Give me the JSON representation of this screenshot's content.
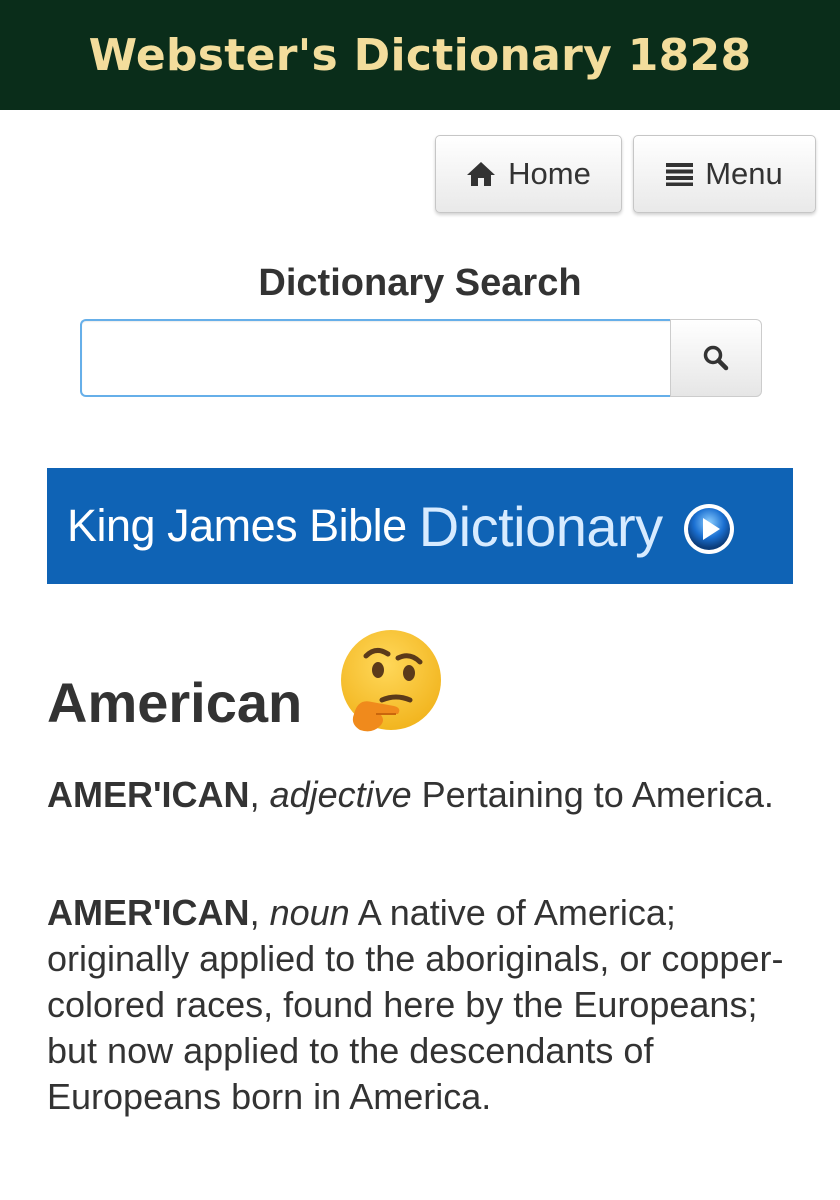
{
  "header": {
    "title": "Webster's Dictionary 1828"
  },
  "nav": {
    "home_label": "Home",
    "home_icon": "home-icon",
    "menu_label": "Menu",
    "menu_icon": "hamburger-menu-icon"
  },
  "search": {
    "heading": "Dictionary Search",
    "value": "",
    "placeholder": "",
    "button_icon": "search-icon"
  },
  "banner": {
    "text_strong": "King James Bible",
    "text_light": "Dictionary",
    "icon": "play-arrow-circle-icon"
  },
  "entry": {
    "title": "American",
    "emoji": "thinking-face-emoji",
    "definitions": [
      {
        "word": "AMER'ICAN",
        "separator": ", ",
        "part_of_speech": "adjective",
        "text": " Pertaining to America."
      },
      {
        "word": "AMER'ICAN",
        "separator": ", ",
        "part_of_speech": "noun",
        "text": " A native of America; originally applied to the aboriginals, or copper-colored races, found here by the Europeans; but now applied to the descendants of Europeans born in America."
      }
    ]
  },
  "colors": {
    "header_bg": "#0a2d1a",
    "header_text": "#f3dd9c",
    "banner_bg": "#0f63b5",
    "input_focus_border": "#66afe9"
  }
}
